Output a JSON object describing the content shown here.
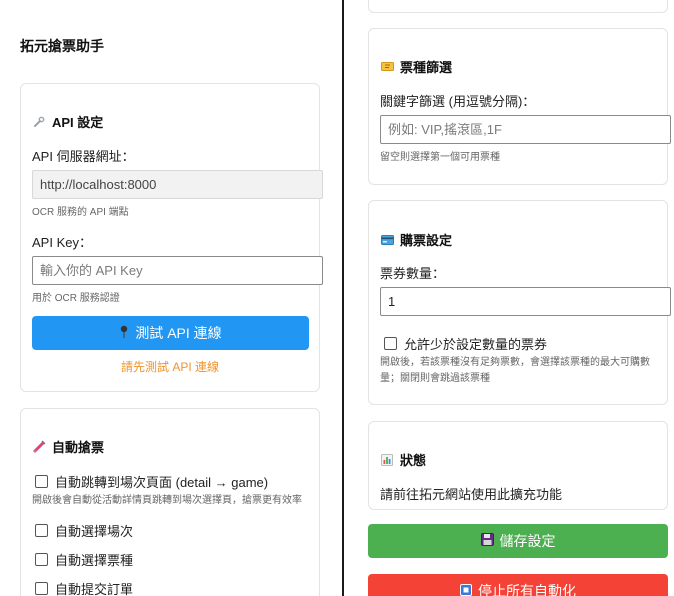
{
  "app": {
    "title": "拓元搶票助手"
  },
  "api_card": {
    "title": "API 設定",
    "icon": "wrench-icon",
    "server_label": "API 伺服器網址：",
    "server_value": "http://localhost:8000",
    "server_hint": "OCR 服務的 API 端點",
    "key_label": "API Key：",
    "key_placeholder": "輸入你的 API Key",
    "key_hint": "用於 OCR 服務認證",
    "test_button": "測試 API 連線",
    "test_button_icon": "pin-icon",
    "warning": "請先測試 API 連線"
  },
  "auto_card": {
    "title": "自動搶票",
    "icon": "syringe-icon",
    "options": [
      {
        "label": "自動跳轉到場次頁面 (detail → game)",
        "checked": false
      },
      {
        "label": "自動選擇場次",
        "checked": false
      },
      {
        "label": "自動選擇票種",
        "checked": false
      },
      {
        "label": "自動提交訂單",
        "checked": false
      }
    ],
    "jump_hint": "開啟後會自動從活動詳情頁跳轉到場次選擇頁，搶票更有效率"
  },
  "ticket_filter_card": {
    "title": "票種篩選",
    "icon": "ticket-icon",
    "keyword_label": "關鍵字篩選 (用逗號分隔)：",
    "keyword_placeholder": "例如: VIP,搖滾區,1F",
    "keyword_hint": "留空則選擇第一個可用票種"
  },
  "purchase_card": {
    "title": "購票設定",
    "icon": "credit-card-icon",
    "quantity_label": "票券數量：",
    "quantity_value": "1",
    "allow_less_label": "允許少於設定數量的票券",
    "allow_less_checked": false,
    "allow_less_hint": "開啟後，若該票種沒有足夠票數，會選擇該票種的最大可購數量；關閉則會跳過該票種"
  },
  "status_card": {
    "title": "狀態",
    "icon": "chart-icon",
    "text": "請前往拓元網站使用此擴充功能"
  },
  "actions": {
    "save": "儲存設定",
    "save_icon": "floppy-disk-icon",
    "stop": "停止所有自動化",
    "stop_icon": "stop-icon"
  },
  "colors": {
    "primary": "#2196f3",
    "success": "#4caf50",
    "danger": "#f44336",
    "warning": "#f0932b"
  }
}
